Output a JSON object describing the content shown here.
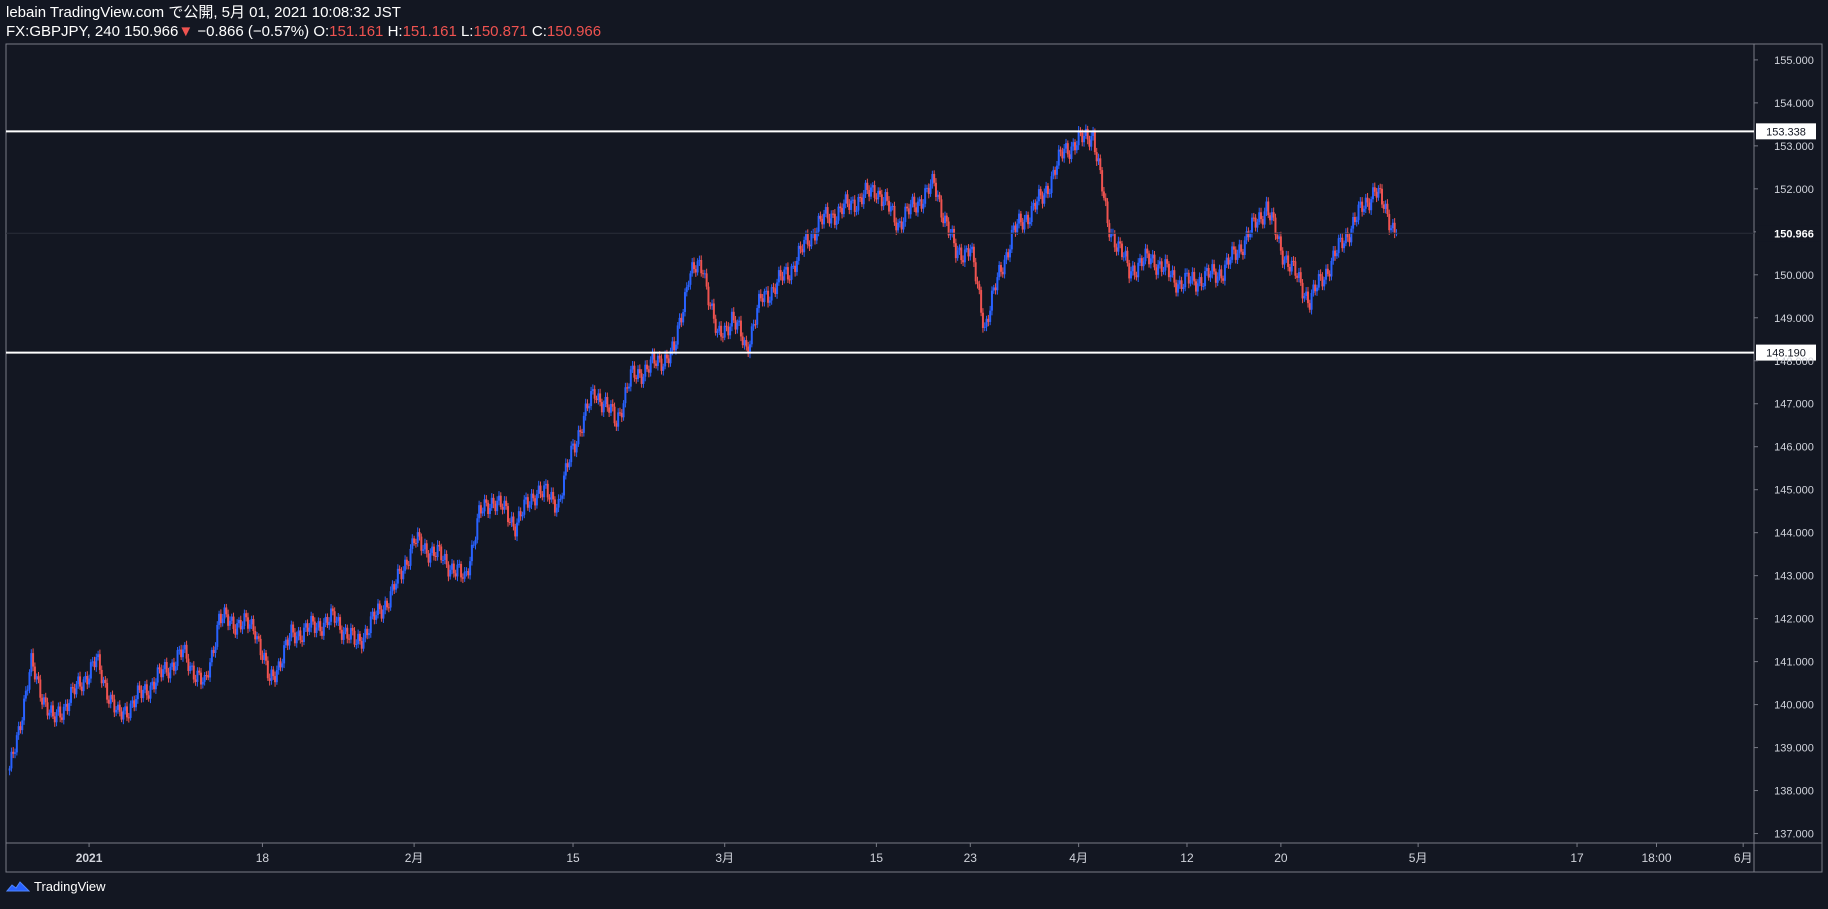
{
  "header": {
    "publish_line": "lebain TradingView.com で公開, 5月 01, 2021 10:08:32 JST",
    "symbol": "FX:GBPJPY, 240",
    "last": "150.966",
    "down_arrow": "▼",
    "change": "−0.866 (−0.57%)",
    "o_label": "O:",
    "o_val": "151.161",
    "h_label": "H:",
    "h_val": "151.161",
    "l_label": "L:",
    "l_val": "150.871",
    "c_label": "C:",
    "c_val": "150.966"
  },
  "footer": {
    "brand": "TradingView"
  },
  "colors": {
    "background": "#131722",
    "up": "#2962ff",
    "down": "#ef5350",
    "level_line": "#ffffff",
    "axis_text": "#d1d4dc",
    "border": "#787b86"
  },
  "chart_data": {
    "type": "candlestick",
    "ylim": [
      136.78,
      155.37
    ],
    "y_ticks": [
      137.0,
      138.0,
      139.0,
      140.0,
      141.0,
      142.0,
      143.0,
      144.0,
      145.0,
      146.0,
      147.0,
      148.0,
      149.0,
      150.0,
      151.0,
      152.0,
      153.0,
      154.0,
      155.0
    ],
    "y_tick_labels": [
      "137.000",
      "138.000",
      "139.000",
      "140.000",
      "141.000",
      "142.000",
      "143.000",
      "144.000",
      "145.000",
      "146.000",
      "147.000",
      "148.000",
      "149.000",
      "150.000",
      "151.000",
      "152.000",
      "153.000",
      "154.000",
      "155.000"
    ],
    "x_ticks": [
      {
        "label": "2021",
        "slot": 11
      },
      {
        "label": "18",
        "slot": 35
      },
      {
        "label": "2月",
        "slot": 56
      },
      {
        "label": "15",
        "slot": 78
      },
      {
        "label": "3月",
        "slot": 99
      },
      {
        "label": "15",
        "slot": 120
      },
      {
        "label": "23",
        "slot": 133
      },
      {
        "label": "4月",
        "slot": 148
      },
      {
        "label": "12",
        "slot": 163
      },
      {
        "label": "20",
        "slot": 176
      },
      {
        "label": "5月",
        "slot": 195
      },
      {
        "label": "17",
        "slot": 217
      },
      {
        "label": "18:00",
        "slot": 228
      },
      {
        "label": "6月",
        "slot": 240
      }
    ],
    "horizontal_levels": [
      {
        "value": 153.338,
        "label": "153.338"
      },
      {
        "value": 148.19,
        "label": "148.190"
      }
    ],
    "last_price": {
      "value": 150.966,
      "label": "150.966"
    },
    "anchors": [
      [
        0,
        138.4
      ],
      [
        3,
        140.9
      ],
      [
        6,
        139.6
      ],
      [
        12,
        141.0
      ],
      [
        15,
        139.7
      ],
      [
        24,
        141.2
      ],
      [
        27,
        140.4
      ],
      [
        29,
        142.0
      ],
      [
        34,
        141.8
      ],
      [
        36,
        140.5
      ],
      [
        39,
        141.6
      ],
      [
        45,
        142.0
      ],
      [
        48,
        141.4
      ],
      [
        53,
        142.6
      ],
      [
        56,
        143.8
      ],
      [
        60,
        143.4
      ],
      [
        63,
        142.9
      ],
      [
        65,
        144.4
      ],
      [
        67,
        144.8
      ],
      [
        70,
        144.2
      ],
      [
        73,
        145.0
      ],
      [
        76,
        144.7
      ],
      [
        78,
        146.0
      ],
      [
        81,
        147.3
      ],
      [
        84,
        146.6
      ],
      [
        86,
        147.6
      ],
      [
        90,
        148.0
      ],
      [
        92,
        148.2
      ],
      [
        94,
        150.0
      ],
      [
        96,
        150.2
      ],
      [
        98,
        148.5
      ],
      [
        100,
        149.0
      ],
      [
        102,
        148.3
      ],
      [
        104,
        149.4
      ],
      [
        108,
        150.1
      ],
      [
        112,
        151.2
      ],
      [
        116,
        151.6
      ],
      [
        120,
        152.0
      ],
      [
        123,
        151.2
      ],
      [
        128,
        152.1
      ],
      [
        131,
        150.5
      ],
      [
        133,
        150.6
      ],
      [
        135,
        148.8
      ],
      [
        137,
        150.0
      ],
      [
        139,
        151.0
      ],
      [
        143,
        151.8
      ],
      [
        146,
        152.9
      ],
      [
        150,
        153.3
      ],
      [
        152,
        151.2
      ],
      [
        155,
        150.1
      ],
      [
        158,
        150.4
      ],
      [
        162,
        149.8
      ],
      [
        165,
        149.9
      ],
      [
        168,
        150.1
      ],
      [
        171,
        150.8
      ],
      [
        174,
        151.6
      ],
      [
        176,
        150.6
      ],
      [
        180,
        149.4
      ],
      [
        183,
        150.3
      ],
      [
        186,
        151.2
      ],
      [
        189,
        152.0
      ],
      [
        192,
        150.966
      ]
    ],
    "total_slots": 242
  }
}
